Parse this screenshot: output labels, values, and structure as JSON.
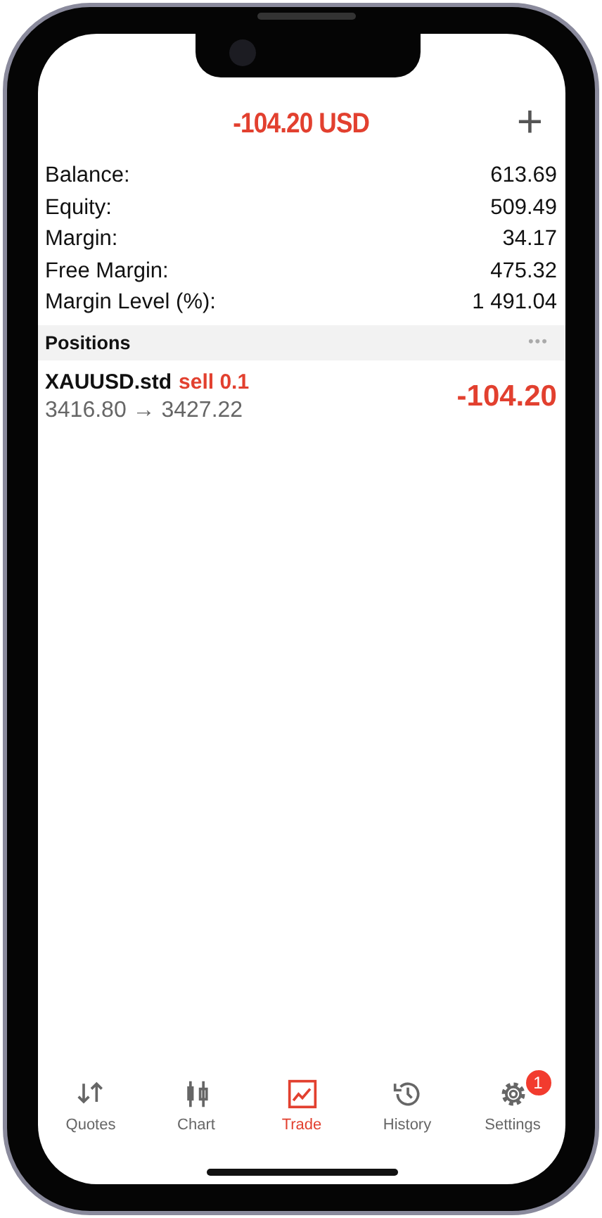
{
  "header": {
    "title": "-104.20 USD",
    "add_button": "+"
  },
  "account": [
    {
      "label": "Balance:",
      "value": "613.69"
    },
    {
      "label": "Equity:",
      "value": "509.49"
    },
    {
      "label": "Margin:",
      "value": "34.17"
    },
    {
      "label": "Free Margin:",
      "value": "475.32"
    },
    {
      "label": "Margin Level (%):",
      "value": "1 491.04"
    }
  ],
  "positions_section": {
    "title": "Positions",
    "more": "•••"
  },
  "positions": [
    {
      "symbol": "XAUUSD.std",
      "side": "sell 0.1",
      "prices": "3416.80 → 3427.22",
      "profit": "-104.20"
    }
  ],
  "tabs": [
    {
      "label": "Quotes",
      "selected": false
    },
    {
      "label": "Chart",
      "selected": false
    },
    {
      "label": "Trade",
      "selected": true
    },
    {
      "label": "History",
      "selected": false
    },
    {
      "label": "Settings",
      "selected": false,
      "badge": "1"
    }
  ]
}
